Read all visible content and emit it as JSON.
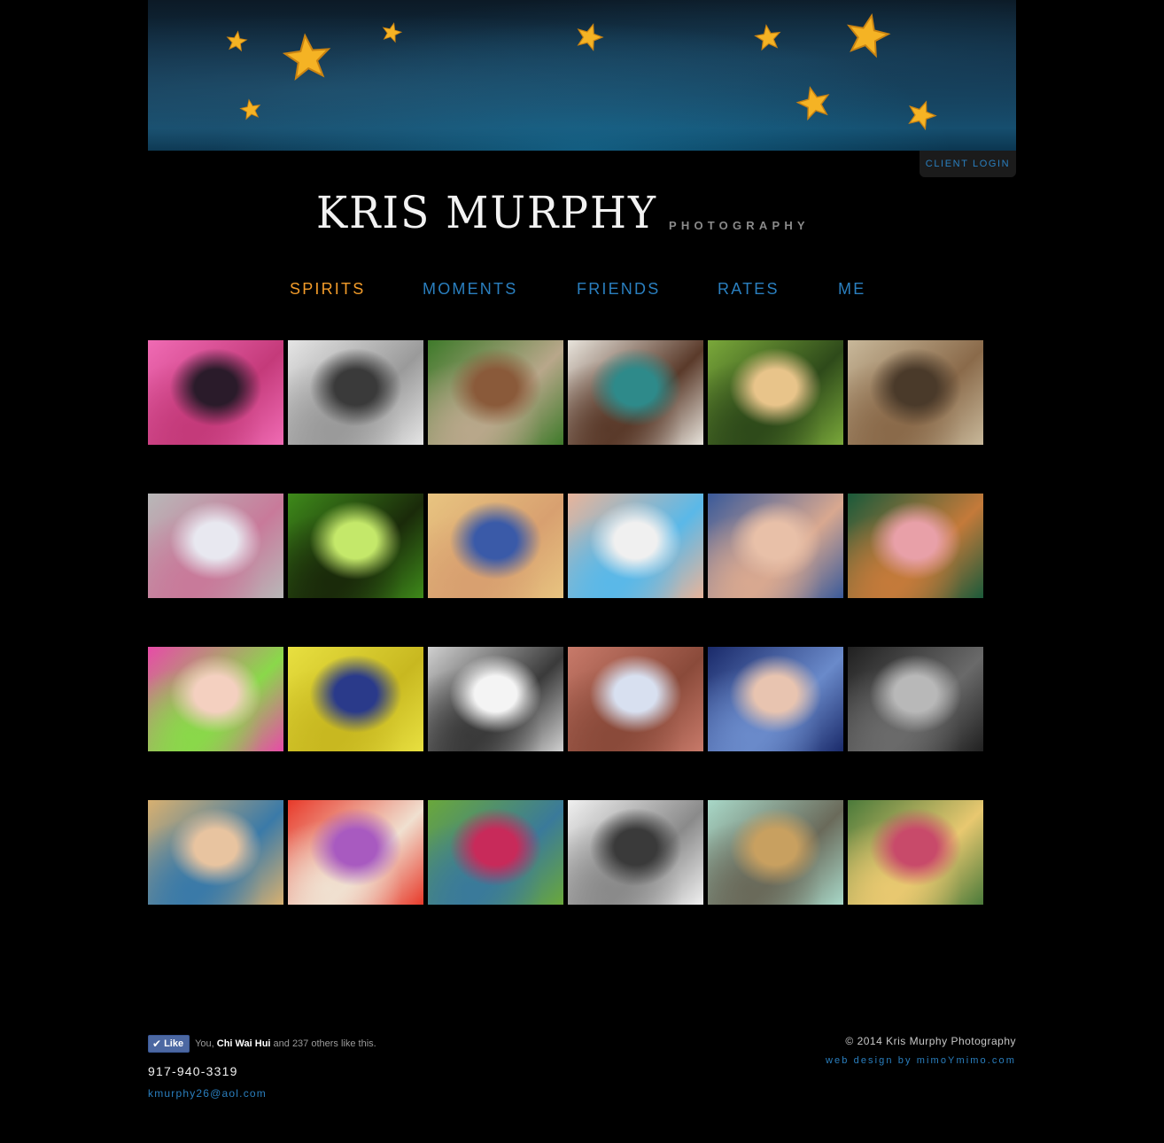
{
  "client_login": "CLIENT LOGIN",
  "logo": {
    "name": "KRIS MURPHY",
    "tagline": "PHOTOGRAPHY"
  },
  "nav": [
    {
      "label": "SPIRITS",
      "active": true
    },
    {
      "label": "MOMENTS",
      "active": false
    },
    {
      "label": "FRIENDS",
      "active": false
    },
    {
      "label": "RATES",
      "active": false
    },
    {
      "label": "ME",
      "active": false
    }
  ],
  "colors": {
    "accent": "#2a7fbf",
    "active": "#f39c2a",
    "background": "#000000",
    "star": "#f5b324"
  },
  "gallery": {
    "rows": 4,
    "columns": 6,
    "photos": [
      "girl-face-paint-pink-tutu",
      "girl-black-white-portrait",
      "girl-blowing-glitter",
      "baby-in-basket",
      "girl-profile-sunlight",
      "child-reading-books",
      "girl-spinning-tutu",
      "toddler-painted-face",
      "girl-blue-hat",
      "baby-pacifier",
      "baby-feet-hands",
      "curly-hair-child",
      "baby-pink-hat",
      "yellow-painted-eye",
      "smiling-toddler-bw",
      "girls-splashing-water",
      "baby-blue-eyes",
      "girl-cap-bw",
      "boy-blue-eyes",
      "girl-red-chair",
      "newborn-stars",
      "toddler-bw-beach",
      "baby-scale-basket",
      "kids-running-costumes"
    ]
  },
  "footer": {
    "like_button": "Like",
    "like_prefix": "You,",
    "like_name": "Chi Wai Hui",
    "like_suffix": "and 237 others like this.",
    "phone": "917-940-3319",
    "email": "kmurphy26@aol.com",
    "copyright": "© 2014 Kris Murphy Photography",
    "credit": "web design by mimoYmimo.com"
  }
}
